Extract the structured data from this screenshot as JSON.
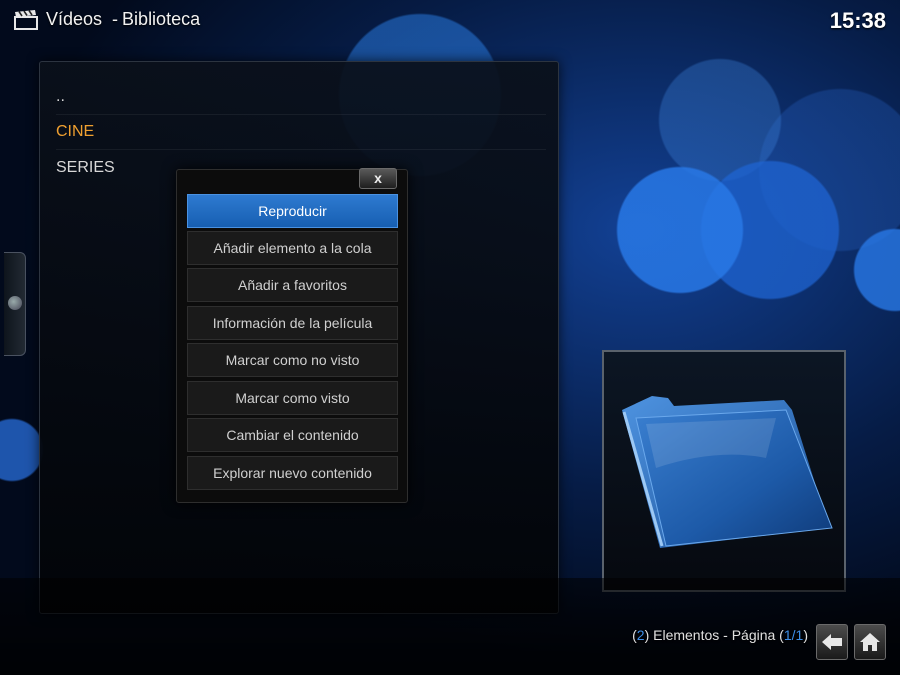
{
  "header": {
    "section": "Vídeos",
    "separator": "-",
    "subsection": "Biblioteca",
    "clock": "15:38",
    "icon": "clapperboard-icon"
  },
  "list": {
    "items": [
      {
        "label": "..",
        "active": false
      },
      {
        "label": "CINE",
        "active": true
      },
      {
        "label": "SERIES",
        "active": false
      }
    ]
  },
  "context_menu": {
    "close_label": "x",
    "items": [
      {
        "label": "Reproducir",
        "focused": true
      },
      {
        "label": "Añadir elemento a la cola",
        "focused": false
      },
      {
        "label": "Añadir a favoritos",
        "focused": false
      },
      {
        "label": "Información de la película",
        "focused": false
      },
      {
        "label": "Marcar como no visto",
        "focused": false
      },
      {
        "label": "Marcar como visto",
        "focused": false
      },
      {
        "label": "Cambiar el contenido",
        "focused": false
      },
      {
        "label": "Explorar nuevo contenido",
        "focused": false
      }
    ]
  },
  "preview": {
    "icon": "folder-icon"
  },
  "footer": {
    "open_paren": "(",
    "count": "2",
    "items_text": ") Elementos - Página (",
    "page": "1/1",
    "close_paren": ")",
    "back_icon": "back-arrow-icon",
    "home_icon": "home-icon"
  },
  "colors": {
    "accent": "#f0a030",
    "focus_blue": "#2e7ad0",
    "counter_blue": "#3d8fe8"
  }
}
